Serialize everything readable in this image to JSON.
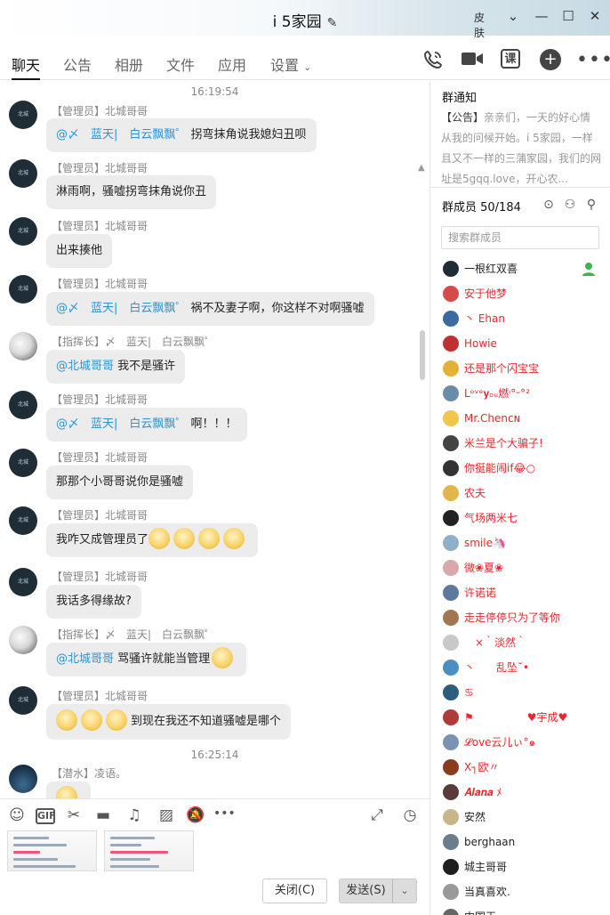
{
  "window": {
    "title": "i 5家园",
    "edit_icon": "pencil-icon",
    "controls": {
      "skin": "皮肤",
      "expand": "⌄",
      "minimize": "—",
      "maximize": "☐",
      "close": "✕"
    }
  },
  "tabs": [
    "聊天",
    "公告",
    "相册",
    "文件",
    "应用",
    "设置"
  ],
  "tab_icons": [
    "phone-icon",
    "video-icon",
    "class-icon",
    "add-circle-icon",
    "more-icon"
  ],
  "tab_ke": "课",
  "messages": [
    {
      "time": "16:19:54"
    },
    {
      "sender": "【管理员】北城哥哥",
      "mention": "@〆　蓝天|　白云飘飘゜",
      "text": "拐弯抹角说我媳妇丑呗"
    },
    {
      "sender": "【管理员】北城哥哥",
      "mention": "",
      "text": "淋雨啊，骚嘘拐弯抹角说你丑"
    },
    {
      "sender": "【管理员】北城哥哥",
      "mention": "",
      "text": "出来揍他"
    },
    {
      "sender": "【管理员】北城哥哥",
      "mention": "@〆　蓝天|　白云飘飘゜",
      "text": "祸不及妻子啊，你这样不对啊骚嘘"
    },
    {
      "sender": "【指挥长】〆　蓝天|　白云飘飘゜",
      "mention": "@北城哥哥",
      "text": "我不是骚许"
    },
    {
      "sender": "【管理员】北城哥哥",
      "mention": "@〆　蓝天|　白云飘飘゜",
      "text": "啊！！！"
    },
    {
      "sender": "【管理员】北城哥哥",
      "mention": "",
      "text": "那那个小哥哥说你是骚嘘"
    },
    {
      "sender": "【管理员】北城哥哥",
      "mention": "",
      "text": "我咋又成管理员了"
    },
    {
      "sender": "【管理员】北城哥哥",
      "mention": "",
      "text": "我话多得缘故?"
    },
    {
      "sender": "【指挥长】〆　蓝天|　白云飘飘゜",
      "mention": "@北城哥哥",
      "text": "骂骚许就能当管理"
    },
    {
      "sender": "【管理员】北城哥哥",
      "mention": "",
      "text": "到现在我还不知道骚嘘是哪个"
    },
    {
      "time": "16:25:14"
    },
    {
      "sender": "【潜水】凌语。",
      "mention": "",
      "text": ""
    }
  ],
  "toolbar": {
    "icons": [
      "emoji-icon",
      "gif-icon",
      "scissors-icon",
      "folder-icon",
      "music-icon",
      "image-icon",
      "bell-off-icon",
      "more-icon",
      "expand-icon",
      "history-icon"
    ],
    "gif_label": "GIF"
  },
  "buttons": {
    "close": "关闭(C)",
    "send": "发送(S)"
  },
  "notice": {
    "title": "群通知",
    "tag": "【公告】",
    "text": "亲亲们，一天的好心情从我的问候开始。i 5家园，一样且又不一样的三蒲家园，我们的网址是5gqq.love，开心农..."
  },
  "members_panel": {
    "title": "群成员 50/184",
    "search_placeholder": "搜索群成员"
  },
  "members": [
    {
      "name": "一根红双喜",
      "color": "#222222"
    },
    {
      "name": "安于他梦",
      "color": "#e8262d"
    },
    {
      "name": "丶 Ehan",
      "color": "#e8262d"
    },
    {
      "name": "Howie",
      "color": "#e8262d"
    },
    {
      "name": "还是那个闪宝宝",
      "color": "#e8262d"
    },
    {
      "name": "Lᵒᵛᵉ𝐲ₒᵤ燃ᵎ°ᵕ°²",
      "color": "#e8262d"
    },
    {
      "name": "Mr.Chenᴄɴ",
      "color": "#e8262d"
    },
    {
      "name": "米兰是个大骗子!",
      "color": "#e8262d"
    },
    {
      "name": "你挺能闹if😂○",
      "color": "#e8262d"
    },
    {
      "name": "农夫",
      "color": "#e8262d"
    },
    {
      "name": "气场两米七",
      "color": "#e8262d"
    },
    {
      "name": "smile🦄",
      "color": "#e8262d"
    },
    {
      "name": "微❀夏❀",
      "color": "#e8262d"
    },
    {
      "name": "许诺诺",
      "color": "#e8262d"
    },
    {
      "name": "走走停停只为了等你",
      "color": "#e8262d"
    },
    {
      "name": "　×｀淡然｀",
      "color": "#e8262d"
    },
    {
      "name": "丶　　乱坠˘•",
      "color": "#e8262d"
    },
    {
      "name": "♋",
      "color": "#e8262d"
    },
    {
      "name": "⚑　　　　　♥宇成♥",
      "color": "#e8262d"
    },
    {
      "name": "𝓛ove云儿ぃ°๑",
      "color": "#e8262d"
    },
    {
      "name": "X┐欧〃",
      "color": "#e8262d"
    },
    {
      "name": "𝑨𝒍𝒂𝒏𝒂 ﾒ",
      "color": "#e8262d"
    },
    {
      "name": "安然",
      "color": "#222222"
    },
    {
      "name": "berghaan",
      "color": "#222222"
    },
    {
      "name": "城主哥哥",
      "color": "#222222"
    },
    {
      "name": "当真喜欢.",
      "color": "#222222"
    },
    {
      "name": "中国王…",
      "color": "#222222"
    }
  ],
  "colors": {
    "mention": "#2b95d6",
    "bubble": "#ececec",
    "accent_red": "#e8262d"
  }
}
